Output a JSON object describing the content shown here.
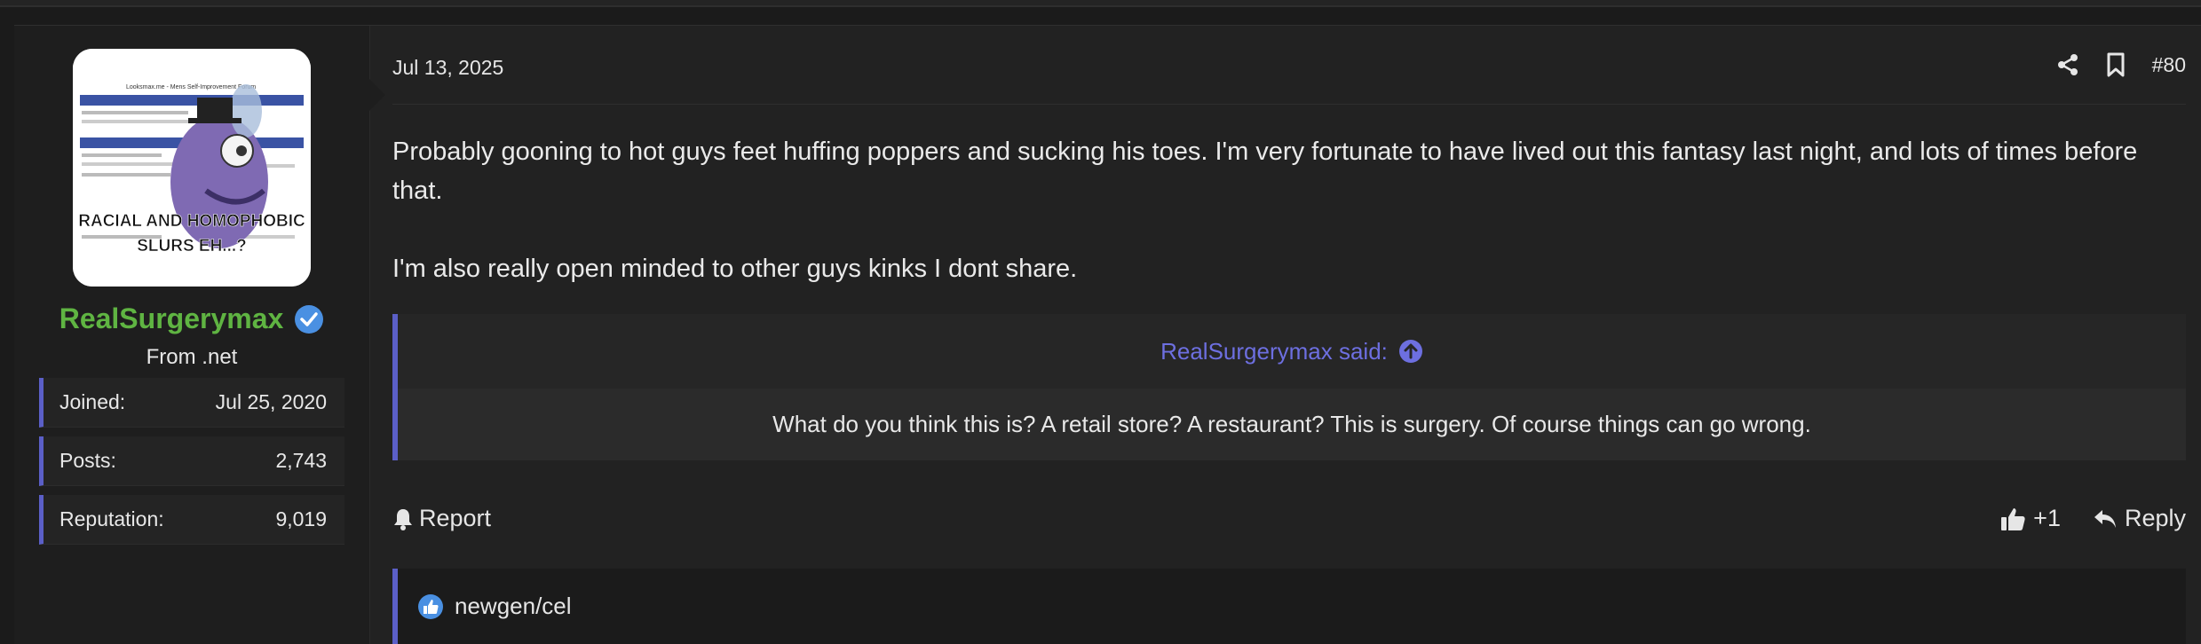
{
  "colors": {
    "accent": "#5b5fc7",
    "username": "#5fb442",
    "verified": "#4a90e2",
    "background": "#222222"
  },
  "author": {
    "name": "RealSurgerymax",
    "title": "From .net",
    "avatar_caption_line1": "RACIAL AND HOMOPHOBIC",
    "avatar_caption_line2": "SLURS EH...?",
    "avatar_header": "Looksmax.me - Mens Self-Improvement Forum",
    "stats": [
      {
        "label": "Joined:",
        "value": "Jul 25, 2020"
      },
      {
        "label": "Posts:",
        "value": "2,743"
      },
      {
        "label": "Reputation:",
        "value": "9,019"
      }
    ]
  },
  "post": {
    "date": "Jul 13, 2025",
    "number": "#80",
    "paragraphs": [
      "Probably gooning to hot guys feet huffing poppers and sucking his toes. I'm very fortunate to have lived out this fantasy last night, and lots of times before that.",
      "I'm also really open minded to other guys kinks I dont share."
    ],
    "quote": {
      "attribution": "RealSurgerymax said:",
      "text": "What do you think this is? A retail store? A restaurant? This is surgery. Of course things can go wrong."
    },
    "footer": {
      "report_label": "Report",
      "reaction_count": "+1",
      "reply_label": "Reply"
    },
    "likes": {
      "users": "newgen/cel"
    }
  },
  "icons": [
    "share-icon",
    "bookmark-icon",
    "bell-icon",
    "thumbs-up-icon",
    "reply-icon",
    "arrow-up-circle-icon",
    "verified-icon",
    "like-badge-icon"
  ]
}
